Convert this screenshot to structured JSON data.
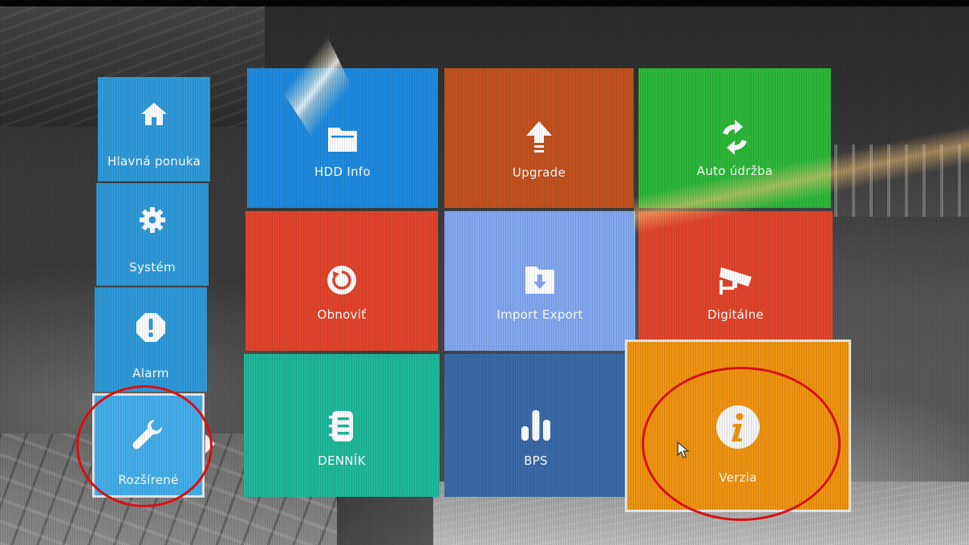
{
  "sidebar": {
    "items": [
      {
        "label": "Hlavná ponuka",
        "icon": "home-icon"
      },
      {
        "label": "Systém",
        "icon": "gear-icon"
      },
      {
        "label": "Alarm",
        "icon": "alert-icon"
      },
      {
        "label": "Rozšírené",
        "icon": "wrench-icon",
        "active": true
      }
    ]
  },
  "tiles": [
    {
      "label": "HDD Info",
      "icon": "folder-icon",
      "color": "#1f8be0"
    },
    {
      "label": "Upgrade",
      "icon": "upgrade-arrow-icon",
      "color": "#c2521f"
    },
    {
      "label": "Auto údržba",
      "icon": "refresh-icon",
      "color": "#2db83a"
    },
    {
      "label": "Obnoviť",
      "icon": "restore-icon",
      "color": "#e2452c"
    },
    {
      "label": "Import Export",
      "icon": "import-export-icon",
      "color": "#82a8f0"
    },
    {
      "label": "Digitálne",
      "icon": "camera-icon",
      "color": "#e0452b"
    },
    {
      "label": "DENNÍK",
      "icon": "log-book-icon",
      "color": "#1fb89a"
    },
    {
      "label": "BPS",
      "icon": "bar-chart-icon",
      "color": "#3a6aa8"
    },
    {
      "label": "Verzia",
      "icon": "info-icon",
      "color": "#ef9412",
      "selected": true
    }
  ],
  "colors": {
    "sidebar_bg": "#2f9ad9",
    "sidebar_active": "#45aeea",
    "annotation": "#e01010",
    "selection_border": "#e9e9e9"
  }
}
